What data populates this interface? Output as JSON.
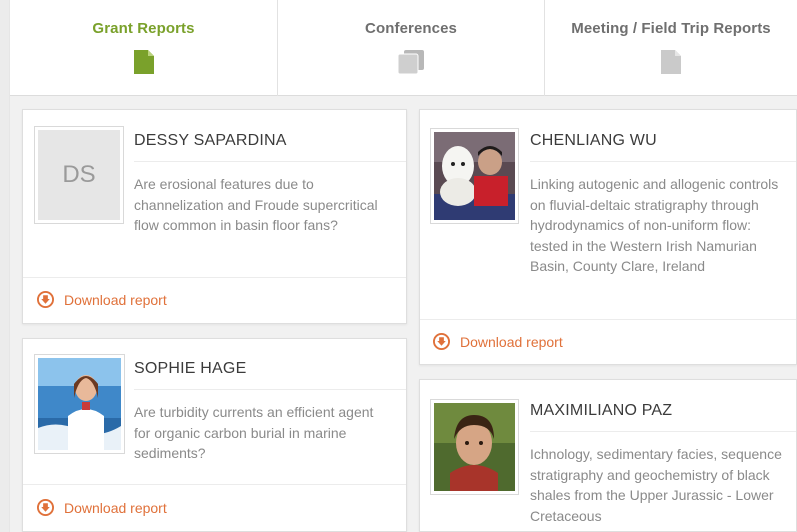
{
  "tabs": [
    {
      "label": "Grant Reports",
      "icon": "document-icon",
      "active": true
    },
    {
      "label": "Conferences",
      "icon": "documents-stack-icon",
      "active": false
    },
    {
      "label": "Meeting / Field Trip Reports",
      "icon": "document-icon",
      "active": false
    }
  ],
  "colors": {
    "accent": "#7aa12b",
    "download": "#e0713a",
    "inactive_icon": "#c4c4c4",
    "text_muted": "#8a8a8a"
  },
  "reports": [
    {
      "name": "DESSY SAPARDINA",
      "initials": "DS",
      "abstract": "Are erosional features due to channelization and Froude supercritical flow common in basin floor fans?",
      "download_label": "Download report"
    },
    {
      "name": "CHENLIANG WU",
      "abstract": "Linking autogenic and allogenic controls on fluvial-deltaic stratigraphy through hydrodynamics of non-uniform flow: tested in the Western Irish Namurian Basin, County Clare, Ireland",
      "download_label": "Download report"
    },
    {
      "name": "SOPHIE HAGE",
      "abstract": "Are turbidity currents an efficient agent for organic carbon burial in marine sediments?",
      "download_label": "Download report"
    },
    {
      "name": "MAXIMILIANO PAZ",
      "abstract": "Ichnology, sedimentary facies, sequence stratigraphy and geochemistry of black shales from the Upper Jurassic - Lower Cretaceous"
    }
  ]
}
